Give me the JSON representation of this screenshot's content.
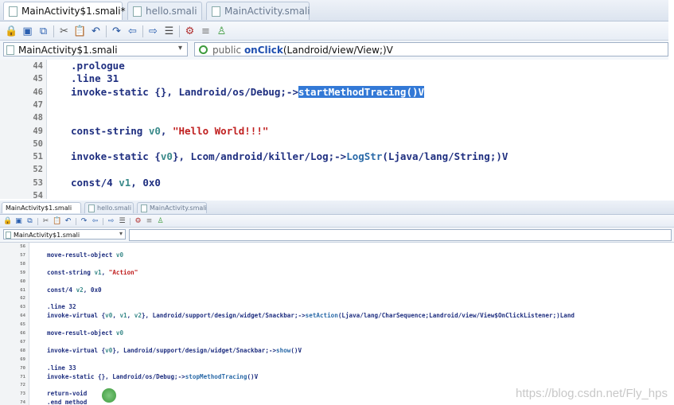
{
  "top": {
    "tabs": [
      {
        "label": "MainActivity$1.smali*",
        "active": true
      },
      {
        "label": "hello.smali",
        "active": false
      },
      {
        "label": "MainActivity.smali",
        "active": false
      }
    ],
    "file_selector": "MainActivity$1.smali",
    "method_selector": {
      "visibility": "public",
      "name": "onClick",
      "signature": "(Landroid/view/View;)V"
    },
    "lines": [
      {
        "num": "44",
        "tokens": [
          {
            "t": ".prologue",
            "c": "kw"
          }
        ]
      },
      {
        "num": "45",
        "tokens": [
          {
            "t": ".line 31",
            "c": "kw"
          }
        ]
      },
      {
        "num": "46",
        "tokens": [
          {
            "t": "invoke-static {}, Landroid/os/Debug;->",
            "c": "kw"
          },
          {
            "t": "startMethodTracing()V",
            "c": "sel"
          }
        ]
      },
      {
        "num": "47",
        "tokens": []
      },
      {
        "num": "48",
        "tokens": []
      },
      {
        "num": "49",
        "tokens": [
          {
            "t": "const-string ",
            "c": "kw"
          },
          {
            "t": "v0",
            "c": "reg"
          },
          {
            "t": ", ",
            "c": "kw"
          },
          {
            "t": "\"Hello World!!!\"",
            "c": "str"
          }
        ]
      },
      {
        "num": "50",
        "tokens": []
      },
      {
        "num": "51",
        "tokens": [
          {
            "t": "invoke-static {",
            "c": "kw"
          },
          {
            "t": "v0",
            "c": "reg"
          },
          {
            "t": "}, Lcom/android/killer/Log;->",
            "c": "kw"
          },
          {
            "t": "LogStr",
            "c": "meth"
          },
          {
            "t": "(Ljava/lang/String;)V",
            "c": "kw"
          }
        ]
      },
      {
        "num": "52",
        "tokens": []
      },
      {
        "num": "53",
        "tokens": [
          {
            "t": "const/4 ",
            "c": "kw"
          },
          {
            "t": "v1",
            "c": "reg"
          },
          {
            "t": ", 0x0",
            "c": "kw"
          }
        ]
      },
      {
        "num": "54",
        "tokens": []
      }
    ]
  },
  "bottom": {
    "tabs": [
      {
        "label": "MainActivity$1.smali",
        "active": true
      },
      {
        "label": "hello.smali",
        "active": false
      },
      {
        "label": "MainActivity.smali",
        "active": false
      }
    ],
    "file_selector": "MainActivity$1.smali",
    "lines": [
      {
        "num": "56",
        "tokens": []
      },
      {
        "num": "57",
        "tokens": [
          {
            "t": "move-result-object ",
            "c": "kw"
          },
          {
            "t": "v0",
            "c": "reg"
          }
        ]
      },
      {
        "num": "58",
        "tokens": []
      },
      {
        "num": "59",
        "tokens": [
          {
            "t": "const-string ",
            "c": "kw"
          },
          {
            "t": "v1",
            "c": "reg"
          },
          {
            "t": ", ",
            "c": "kw"
          },
          {
            "t": "\"Action\"",
            "c": "str"
          }
        ]
      },
      {
        "num": "60",
        "tokens": []
      },
      {
        "num": "61",
        "tokens": [
          {
            "t": "const/4 ",
            "c": "kw"
          },
          {
            "t": "v2",
            "c": "reg"
          },
          {
            "t": ", 0x0",
            "c": "kw"
          }
        ]
      },
      {
        "num": "62",
        "tokens": []
      },
      {
        "num": "63",
        "tokens": [
          {
            "t": ".line 32",
            "c": "kw"
          }
        ]
      },
      {
        "num": "64",
        "tokens": [
          {
            "t": "invoke-virtual {",
            "c": "kw"
          },
          {
            "t": "v0",
            "c": "reg"
          },
          {
            "t": ", ",
            "c": "kw"
          },
          {
            "t": "v1",
            "c": "reg"
          },
          {
            "t": ", ",
            "c": "kw"
          },
          {
            "t": "v2",
            "c": "reg"
          },
          {
            "t": "}, Landroid/support/design/widget/Snackbar;->",
            "c": "kw"
          },
          {
            "t": "setAction",
            "c": "meth"
          },
          {
            "t": "(Ljava/lang/CharSequence;Landroid/view/View$OnClickListener;)Land",
            "c": "kw"
          }
        ]
      },
      {
        "num": "65",
        "tokens": []
      },
      {
        "num": "66",
        "tokens": [
          {
            "t": "move-result-object ",
            "c": "kw"
          },
          {
            "t": "v0",
            "c": "reg"
          }
        ]
      },
      {
        "num": "67",
        "tokens": []
      },
      {
        "num": "68",
        "tokens": [
          {
            "t": "invoke-virtual {",
            "c": "kw"
          },
          {
            "t": "v0",
            "c": "reg"
          },
          {
            "t": "}, Landroid/support/design/widget/Snackbar;->",
            "c": "kw"
          },
          {
            "t": "show",
            "c": "meth"
          },
          {
            "t": "()V",
            "c": "kw"
          }
        ]
      },
      {
        "num": "69",
        "tokens": []
      },
      {
        "num": "70",
        "tokens": [
          {
            "t": ".line 33",
            "c": "kw"
          }
        ]
      },
      {
        "num": "71",
        "tokens": [
          {
            "t": "invoke-static {}, Landroid/os/Debug;->",
            "c": "kw"
          },
          {
            "t": "stopMethodTracing",
            "c": "meth"
          },
          {
            "t": "()V",
            "c": "kw"
          }
        ]
      },
      {
        "num": "72",
        "tokens": []
      },
      {
        "num": "73",
        "tokens": [
          {
            "t": "return-void",
            "c": "kw"
          }
        ]
      },
      {
        "num": "74",
        "tokens": [
          {
            "t": ".end method",
            "c": "kw"
          }
        ]
      }
    ]
  },
  "watermark": "https://blog.csdn.net/Fly_hps",
  "icons": [
    "lock-icon",
    "save-icon",
    "copy-icon",
    "cut-icon",
    "paste-icon",
    "undo-icon",
    "redo-icon",
    "back-icon",
    "forward-icon",
    "format-icon",
    "tool-icon",
    "list-icon",
    "android-icon"
  ],
  "colors": {
    "selection": "#3379d6",
    "string": "#c02020",
    "register": "#3a8a8a",
    "method": "#2a6aa8",
    "keyword": "#1f2f80"
  }
}
